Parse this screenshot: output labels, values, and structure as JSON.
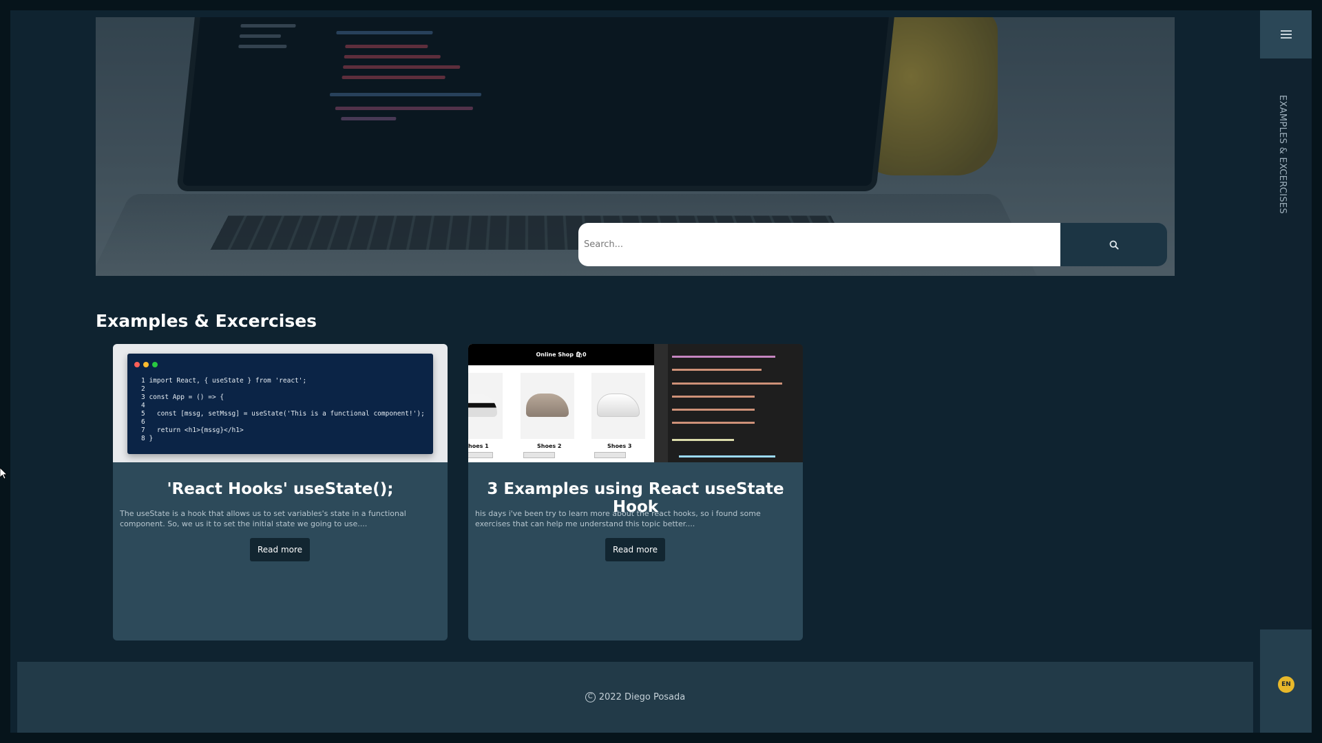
{
  "sidebar": {
    "vertical_label": "EXAMPLES & EXCERCISES",
    "language": "EN",
    "language_color": "#e8b82a"
  },
  "hero": {
    "search": {
      "placeholder": "Search..."
    }
  },
  "section": {
    "title": "Examples & Excercises"
  },
  "cards": [
    {
      "title": "'React Hooks' useState();",
      "description": "The useState is a hook that allows us to set variables's state in a functional component. So, we us it to set the initial state we going to use....",
      "button": "Read more",
      "image_code": {
        "lines": [
          "1 import React, { useState } from 'react';",
          "2",
          "3 const App = () => {",
          "4",
          "5   const [mssg, setMssg] = useState('This is a functional component!');",
          "6",
          "7   return <h1>{mssg}</h1>",
          "8 }"
        ]
      }
    },
    {
      "title": "3 Examples using React useState Hook",
      "description": "his days i've been try to learn more about the react hooks, so i found some exercises that can help me understand this topic better....",
      "button": "Read more",
      "image_shop": {
        "header": "Online Shop 🛍0",
        "items": [
          "hoes 1",
          "Shoes 2",
          "Shoes 3"
        ],
        "add_button": "Add to cart"
      }
    }
  ],
  "footer": {
    "copyright": "2022 Diego Posada"
  },
  "colors": {
    "background": "#0f2330",
    "card": "#2d4a5a",
    "footer": "#223a48",
    "search_button": "#1c3544"
  }
}
